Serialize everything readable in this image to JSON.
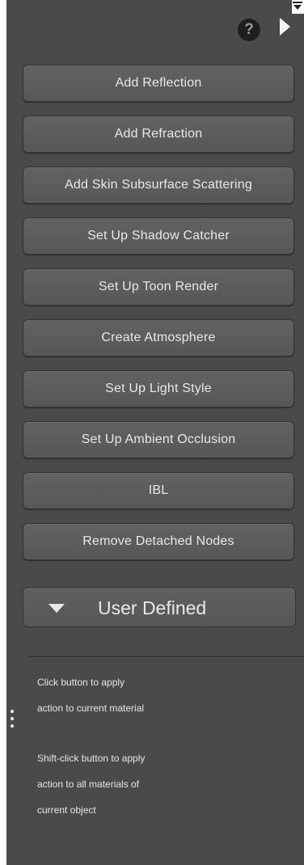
{
  "header": {
    "help_icon": "question-circle-icon",
    "help_glyph": "?",
    "play_icon": "play-triangle-icon",
    "menu_icon": "panel-menu-icon"
  },
  "actions": [
    {
      "label": "Add Reflection"
    },
    {
      "label": "Add Refraction"
    },
    {
      "label": "Add Skin Subsurface Scattering"
    },
    {
      "label": "Set Up Shadow Catcher"
    },
    {
      "label": "Set Up Toon Render"
    },
    {
      "label": "Create Atmosphere"
    },
    {
      "label": "Set Up Light Style"
    },
    {
      "label": "Set Up Ambient Occlusion"
    },
    {
      "label": "IBL"
    },
    {
      "label": "Remove Detached Nodes"
    }
  ],
  "user_defined": {
    "label": "User Defined",
    "icon": "chevron-down-icon"
  },
  "help": {
    "lines_click": [
      "Click button to apply",
      "action to current material"
    ],
    "lines_shift": [
      "Shift-click button to apply",
      "action to all materials of",
      "current object"
    ]
  },
  "colors": {
    "panel_bg": "#4a4a4a",
    "button_bg": "#5c5c5c",
    "text": "#e8e8e8"
  }
}
